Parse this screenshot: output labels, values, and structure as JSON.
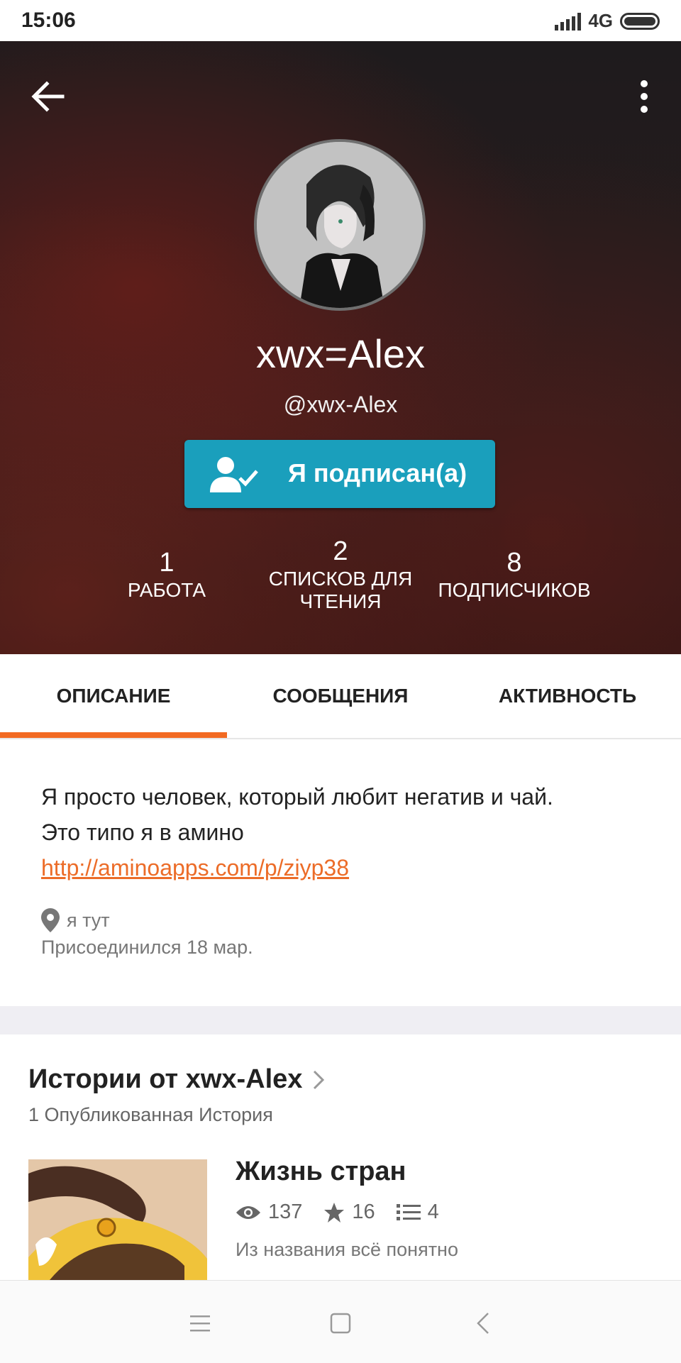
{
  "status_bar": {
    "time": "15:06",
    "network": "4G",
    "icons": [
      "signal-icon",
      "battery-icon"
    ]
  },
  "header": {
    "back_icon": "arrow-left-icon",
    "menu_icon": "more-vertical-icon",
    "username": "xwx=Alex",
    "handle": "@xwx-Alex",
    "follow_button": {
      "label": "Я подписан(а)",
      "icon": "person-check-icon",
      "color": "#1a9fbc"
    },
    "stats": [
      {
        "value": "1",
        "label": "РАБОТА"
      },
      {
        "value": "2",
        "label_line1": "СПИСКОВ ДЛЯ",
        "label_line2": "ЧТЕНИЯ"
      },
      {
        "value": "8",
        "label": "ПОДПИСЧИКОВ"
      }
    ]
  },
  "tabs": {
    "items": [
      "ОПИСАНИЕ",
      "СООБЩЕНИЯ",
      "АКТИВНОСТЬ"
    ],
    "active": "ОПИСАНИЕ",
    "accent": "#f26a22"
  },
  "description": {
    "line1": "Я просто человек, который любит негатив и чай.",
    "line2": "Это типо я в амино",
    "link": "http://aminoapps.com/p/ziyp38",
    "location": "я тут",
    "joined": "Присоединился 18 мар."
  },
  "stories": {
    "title": "Истории от xwx-Alex",
    "count": "1 Опубликованная История",
    "items": [
      {
        "title": "Жизнь стран",
        "views": "137",
        "votes": "16",
        "parts": "4",
        "description": "Из названия всё понятно"
      }
    ]
  },
  "nav_bar": {
    "icons": [
      "menu-icon",
      "home-square-icon",
      "back-chevron-icon"
    ]
  }
}
